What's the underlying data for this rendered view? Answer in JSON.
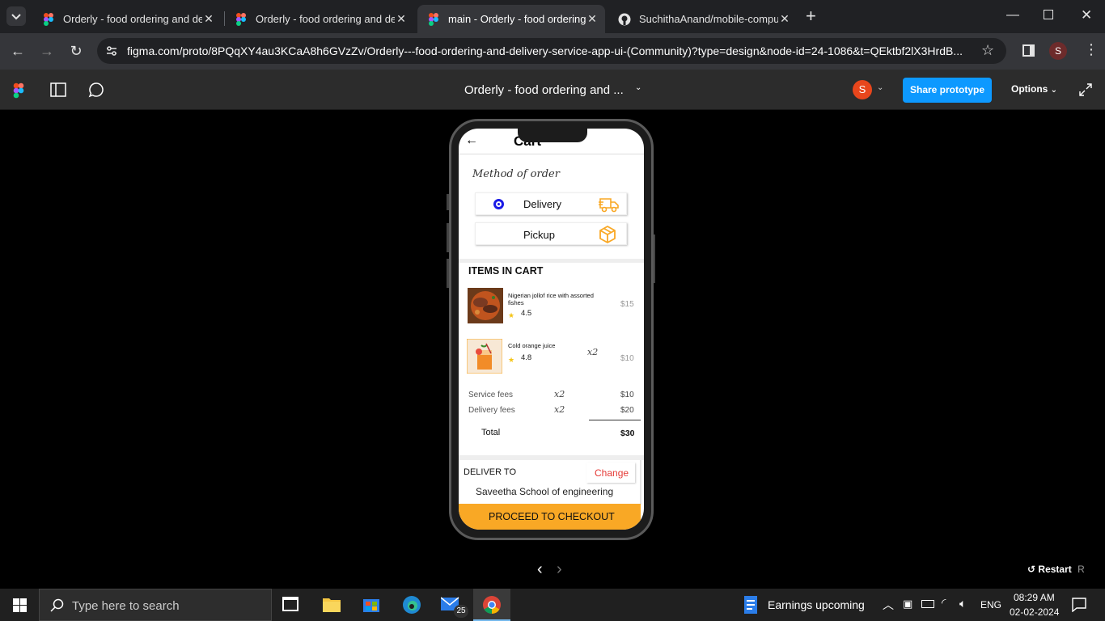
{
  "browser": {
    "tabs": [
      {
        "title": "Orderly - food ordering and del",
        "active": false
      },
      {
        "title": "Orderly - food ordering and del",
        "active": false
      },
      {
        "title": "main - Orderly - food ordering",
        "active": true
      },
      {
        "title": "SuchithaAnand/mobile-comput",
        "active": false
      }
    ],
    "url": "figma.com/proto/8PQqXY4au3KCaA8h6GVzZv/Orderly---food-ordering-and-delivery-service-app-ui-(Community)?type=design&node-id=24-1086&t=QEktbf2lX3HrdB...",
    "profile_initial": "S"
  },
  "figma": {
    "doc_title": "Orderly - food ordering and ...",
    "avatar_initial": "S",
    "share_label": "Share prototype",
    "options_label": "Options",
    "restart_label": "Restart",
    "restart_key": "R"
  },
  "app": {
    "title": "Cart",
    "method_label": "Method of order",
    "delivery_label": "Delivery",
    "pickup_label": "Pickup",
    "items_heading": "ITEMS IN CART",
    "items": [
      {
        "name": "Nigerian jollof rice with assorted fishes",
        "rating": "4.5",
        "qty": "",
        "price": "$15"
      },
      {
        "name": "Cold orange juice",
        "rating": "4.8",
        "qty": "x2",
        "price": "$10"
      }
    ],
    "fees": [
      {
        "label": "Service fees",
        "qty": "x2",
        "amount": "$10"
      },
      {
        "label": "Delivery fees",
        "qty": "x2",
        "amount": "$20"
      }
    ],
    "total_label": "Total",
    "total_amount": "$30",
    "deliver_to_label": "DELIVER TO",
    "change_label": "Change",
    "address": "Saveetha School of engineering",
    "checkout_label": "PROCEED TO CHECKOUT",
    "accent": "#f9a825"
  },
  "taskbar": {
    "search_placeholder": "Type here to search",
    "mail_badge": "25",
    "news": "Earnings upcoming",
    "lang": "ENG",
    "time": "08:29 AM",
    "date": "02-02-2024"
  }
}
